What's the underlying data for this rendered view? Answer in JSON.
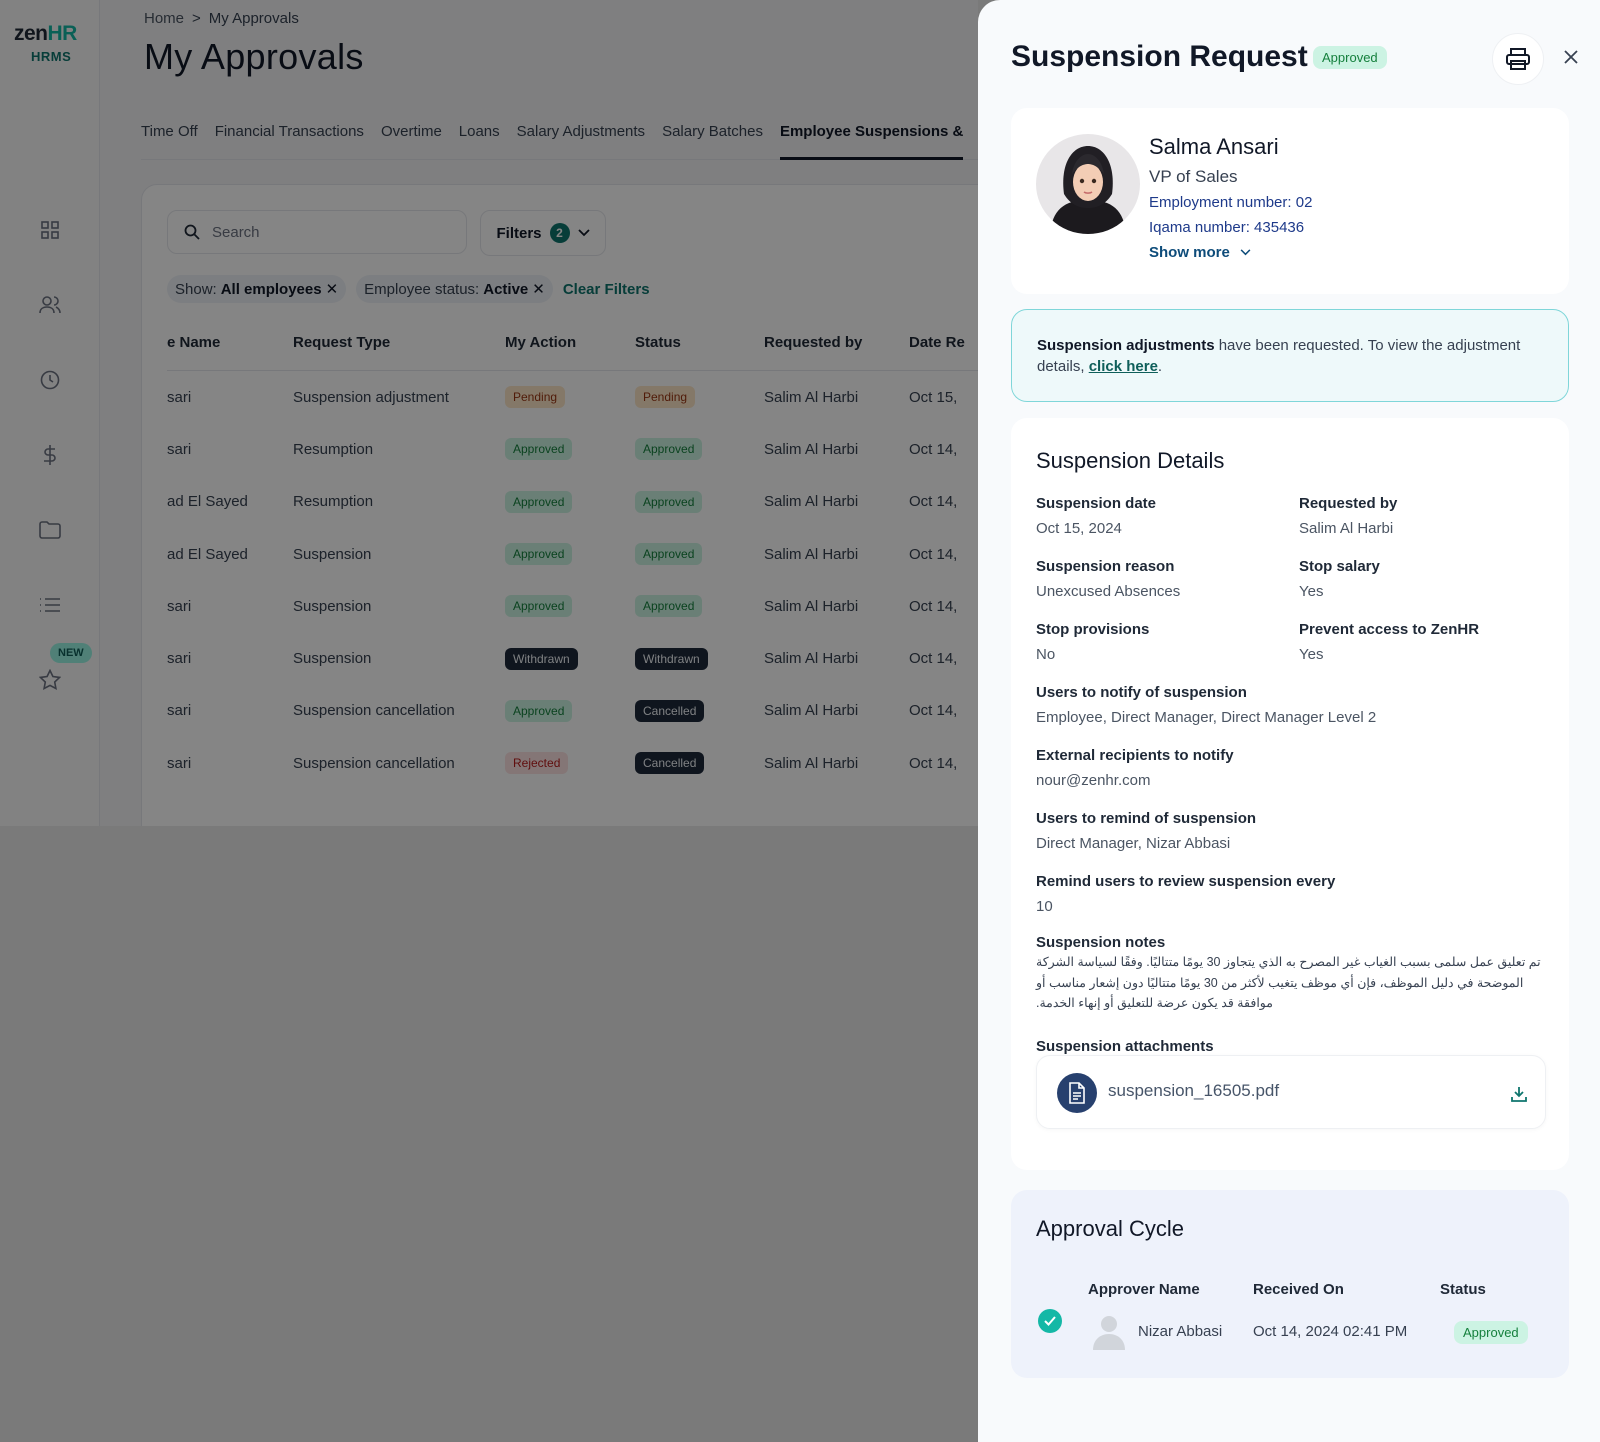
{
  "app": {
    "logo_prefix": "zen",
    "logo_suffix": "HR",
    "logo_sub": "HRMS",
    "new_badge": "NEW",
    "nav_icons": [
      "dashboard-icon",
      "people-icon",
      "clock-icon",
      "dollar-icon",
      "folder-icon",
      "list-icon",
      "star-icon"
    ]
  },
  "breadcrumb": {
    "home": "Home",
    "separator": ">",
    "current": "My Approvals"
  },
  "page_title": "My Approvals",
  "tabs": [
    "Time Off",
    "Financial Transactions",
    "Overtime",
    "Loans",
    "Salary Adjustments",
    "Salary Batches",
    "Employee Suspensions &"
  ],
  "active_tab": "Employee Suspensions &",
  "toolbar": {
    "search_placeholder": "Search",
    "filters_label": "Filters",
    "filters_count": "2"
  },
  "chips": [
    {
      "label": "Show:",
      "value": "All employees"
    },
    {
      "label": "Employee status:",
      "value": "Active"
    }
  ],
  "clear_filters": "Clear Filters",
  "table": {
    "headers": [
      "e Name",
      "Request Type",
      "My Action",
      "Status",
      "Requested by",
      "Date Re"
    ],
    "rows": [
      {
        "name": "sari",
        "type": "Suspension adjustment",
        "action": "Pending",
        "status": "Pending",
        "by": "Salim Al Harbi",
        "date": "Oct 15,"
      },
      {
        "name": "sari",
        "type": "Resumption",
        "action": "Approved",
        "status": "Approved",
        "by": "Salim Al Harbi",
        "date": "Oct 14,"
      },
      {
        "name": "ad El Sayed",
        "type": "Resumption",
        "action": "Approved",
        "status": "Approved",
        "by": "Salim Al Harbi",
        "date": "Oct 14,"
      },
      {
        "name": "ad El Sayed",
        "type": "Suspension",
        "action": "Approved",
        "status": "Approved",
        "by": "Salim Al Harbi",
        "date": "Oct 14,"
      },
      {
        "name": "sari",
        "type": "Suspension",
        "action": "Approved",
        "status": "Approved",
        "by": "Salim Al Harbi",
        "date": "Oct 14,"
      },
      {
        "name": "sari",
        "type": "Suspension",
        "action": "Withdrawn",
        "status": "Withdrawn",
        "by": "Salim Al Harbi",
        "date": "Oct 14,"
      },
      {
        "name": "sari",
        "type": "Suspension cancellation",
        "action": "Approved",
        "status": "Cancelled",
        "by": "Salim Al Harbi",
        "date": "Oct 14,"
      },
      {
        "name": "sari",
        "type": "Suspension cancellation",
        "action": "Rejected",
        "status": "Cancelled",
        "by": "Salim Al Harbi",
        "date": "Oct 14,"
      }
    ]
  },
  "drawer": {
    "title": "Suspension Request",
    "status": "Approved",
    "employee": {
      "name": "Salma Ansari",
      "role": "VP of Sales",
      "employment_number": "Employment number: 02",
      "iqama_number": "Iqama number: 435436",
      "show_more": "Show more"
    },
    "notice": {
      "bold": "Suspension adjustments",
      "text": " have been requested. To view the adjustment details, ",
      "link": "click here",
      "end": "."
    },
    "details": {
      "title": "Suspension Details",
      "suspension_date_label": "Suspension date",
      "suspension_date": "Oct 15, 2024",
      "requested_by_label": "Requested by",
      "requested_by": "Salim Al Harbi",
      "reason_label": "Suspension reason",
      "reason": "Unexcused Absences",
      "stop_salary_label": "Stop salary",
      "stop_salary": "Yes",
      "stop_provisions_label": "Stop provisions",
      "stop_provisions": "No",
      "prevent_access_label": "Prevent access to ZenHR",
      "prevent_access": "Yes",
      "notify_label": "Users to notify of suspension",
      "notify": "Employee, Direct Manager, Direct Manager Level 2",
      "external_label": "External recipients to notify",
      "external": "nour@zenhr.com",
      "remind_users_label": "Users to remind of suspension",
      "remind_users": "Direct Manager, Nizar Abbasi",
      "remind_every_label": "Remind users to review suspension every",
      "remind_every": "10",
      "notes_label": "Suspension notes",
      "notes": "تم تعليق عمل سلمى بسبب الغياب غير المصرح به الذي يتجاوز 30 يومًا متتاليًا. وفقًا لسياسة الشركة الموضحة في دليل الموظف، فإن أي موظف يتغيب لأكثر من 30 يومًا متتاليًا دون إشعار مناسب أو موافقة قد يكون عرضة للتعليق أو إنهاء الخدمة.",
      "attachments_label": "Suspension attachments",
      "attachment_file": "suspension_16505.pdf"
    },
    "approval": {
      "title": "Approval Cycle",
      "headers": [
        "Approver Name",
        "Received On",
        "Status"
      ],
      "approver": "Nizar Abbasi",
      "received_on": "Oct 14, 2024 02:41 PM",
      "status": "Approved"
    }
  },
  "colors": {
    "accent": "#0f766e",
    "approved_bg": "#ccf3e3",
    "approved_text": "#15803d",
    "pending_bg": "#fde7c7",
    "dark_pill": "#1e293b",
    "rejected_bg": "#fde2e2"
  }
}
